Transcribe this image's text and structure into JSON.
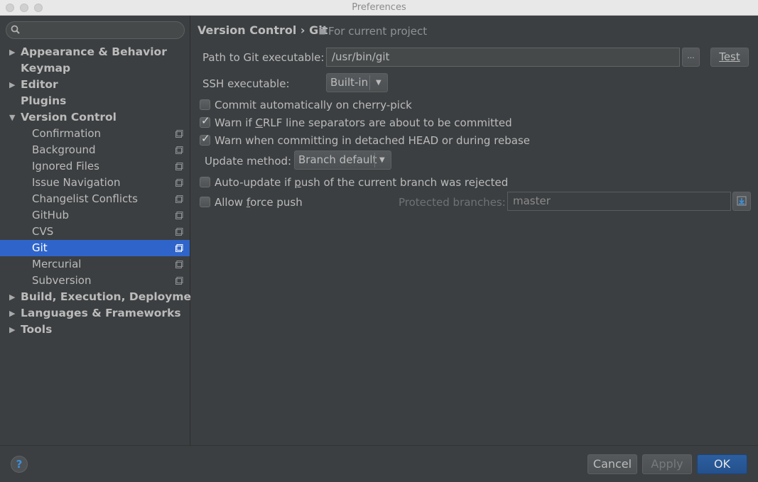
{
  "window": {
    "title": "Preferences"
  },
  "search": {
    "placeholder": ""
  },
  "sidebar": {
    "items": [
      {
        "label": "Appearance & Behavior",
        "level": "top",
        "arrow": "collapsed"
      },
      {
        "label": "Keymap",
        "level": "top",
        "arrow": "none"
      },
      {
        "label": "Editor",
        "level": "top",
        "arrow": "collapsed"
      },
      {
        "label": "Plugins",
        "level": "top",
        "arrow": "none"
      },
      {
        "label": "Version Control",
        "level": "top",
        "arrow": "expanded"
      },
      {
        "label": "Confirmation",
        "level": "sub",
        "project": true
      },
      {
        "label": "Background",
        "level": "sub",
        "project": true
      },
      {
        "label": "Ignored Files",
        "level": "sub",
        "project": true
      },
      {
        "label": "Issue Navigation",
        "level": "sub",
        "project": true
      },
      {
        "label": "Changelist Conflicts",
        "level": "sub",
        "project": true
      },
      {
        "label": "GitHub",
        "level": "sub",
        "project": true
      },
      {
        "label": "CVS",
        "level": "sub",
        "project": true
      },
      {
        "label": "Git",
        "level": "sub",
        "project": true,
        "selected": true
      },
      {
        "label": "Mercurial",
        "level": "sub",
        "project": true
      },
      {
        "label": "Subversion",
        "level": "sub",
        "project": true
      },
      {
        "label": "Build, Execution, Deployment",
        "level": "top",
        "arrow": "collapsed"
      },
      {
        "label": "Languages & Frameworks",
        "level": "top",
        "arrow": "collapsed"
      },
      {
        "label": "Tools",
        "level": "top",
        "arrow": "collapsed"
      }
    ]
  },
  "header": {
    "breadcrumb": "Version Control › Git",
    "scope": "For current project"
  },
  "form": {
    "path_label": "Path to Git executable:",
    "path_value": "/usr/bin/git",
    "browse_label": "...",
    "test_label": "Test",
    "ssh_label": "SSH executable:",
    "ssh_value": "Built-in",
    "cherry_pick": {
      "label": "Commit automatically on cherry-pick",
      "checked": false
    },
    "crlf": {
      "pre": "Warn if ",
      "u": "C",
      "post": "RLF line separators are about to be committed",
      "checked": true
    },
    "detached": {
      "label": "Warn when committing in detached HEAD or during rebase",
      "checked": true
    },
    "update_label": "Update method:",
    "update_value": "Branch default",
    "auto_update": {
      "pre": "Auto-update if ",
      "u": "p",
      "post": "ush of the current branch was rejected",
      "checked": false
    },
    "force_push": {
      "pre": "Allow ",
      "u": "f",
      "post": "orce push",
      "checked": false
    },
    "protected_label": "Protected branches:",
    "protected_value": "master"
  },
  "footer": {
    "help_label": "?",
    "cancel_label": "Cancel",
    "apply_label": "Apply",
    "ok_label": "OK"
  },
  "colors": {
    "background": "#3c3f41",
    "selection": "#2f65ca",
    "primary_button": "#2c5ea0"
  }
}
